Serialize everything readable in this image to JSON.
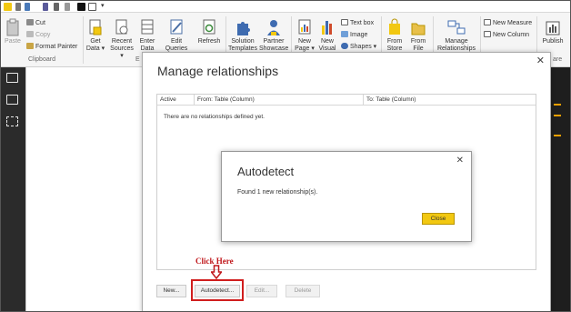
{
  "colors": {
    "accent_yellow": "#f2c811",
    "annotation_red": "#d01e1e",
    "rail_dark": "#2b2b2b"
  },
  "ribbon": {
    "clipboard": {
      "paste": "Paste",
      "cut": "Cut",
      "copy": "Copy",
      "format_painter": "Format Painter",
      "group_label": "Clipboard",
      "next_group_label_fragment": "E"
    },
    "buttons": {
      "get_data": [
        "Get",
        "Data ▾"
      ],
      "recent_sources": [
        "Recent",
        "Sources ▾"
      ],
      "enter_data": [
        "Enter",
        "Data"
      ],
      "edit_queries": [
        "Edit",
        "Queries ▾"
      ],
      "refresh": [
        "Refresh"
      ],
      "solution_templates": [
        "Solution",
        "Templates"
      ],
      "partner_showcase": [
        "Partner",
        "Showcase"
      ],
      "new_page": [
        "New",
        "Page ▾"
      ],
      "new_visual": [
        "New",
        "Visual"
      ],
      "from_store": [
        "From",
        "Store"
      ],
      "from_file": [
        "From",
        "File"
      ],
      "manage_relationships": [
        "Manage",
        "Relationships"
      ],
      "publish": [
        "Publish"
      ]
    },
    "insert": {
      "text_box": "Text box",
      "image": "Image",
      "shapes": "Shapes ▾"
    },
    "calc": {
      "new_measure": "New Measure",
      "new_column": "New Column"
    },
    "share_fragment": "are"
  },
  "dialog": {
    "title": "Manage relationships",
    "close": "✕",
    "columns": {
      "active": "Active",
      "from": "From: Table (Column)",
      "to": "To: Table (Column)"
    },
    "empty_message": "There are no relationships defined yet.",
    "buttons": {
      "new": "New...",
      "autodetect": "Autodetect...",
      "edit": "Edit...",
      "delete": "Delete"
    }
  },
  "annotation": {
    "text": "Click Here"
  },
  "popup": {
    "title": "Autodetect",
    "close": "✕",
    "message": "Found 1 new relationship(s).",
    "close_button": "Close"
  }
}
